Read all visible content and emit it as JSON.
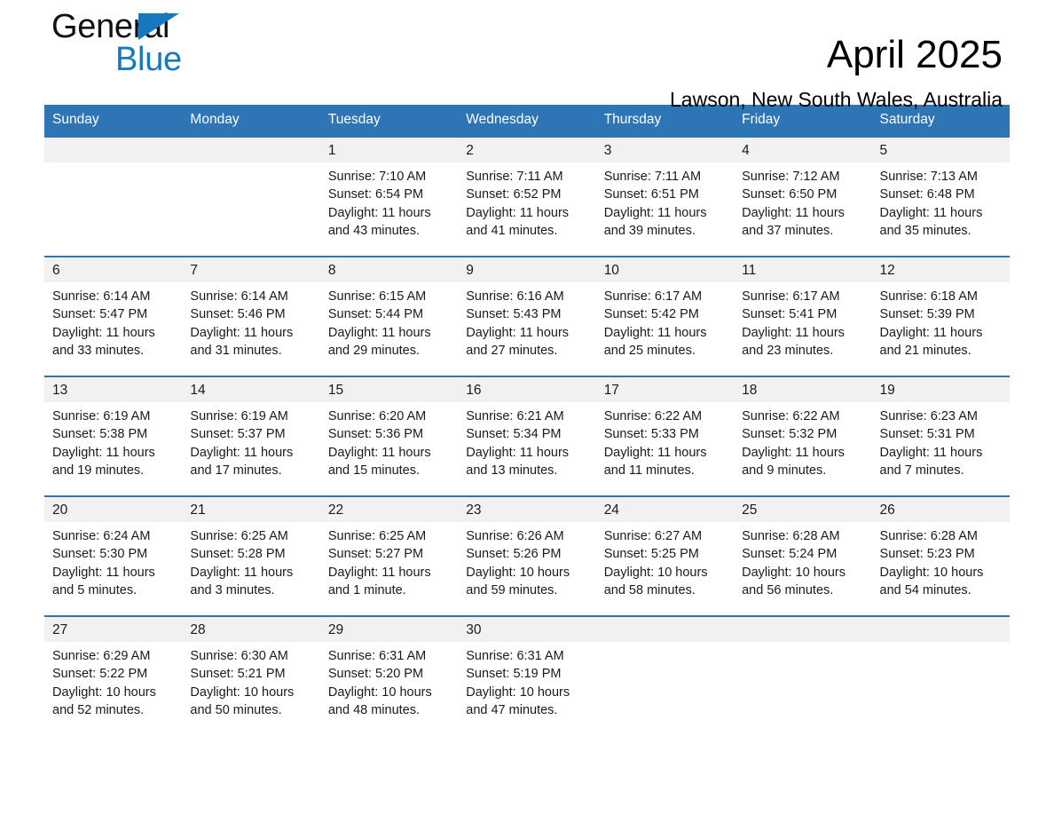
{
  "brand": {
    "name_part1": "General",
    "name_part2": "Blue",
    "accent_color": "#1878be"
  },
  "header": {
    "title": "April 2025",
    "subtitle": "Lawson, New South Wales, Australia"
  },
  "theme": {
    "header_blue": "#2e75b6",
    "daynum_band_gray": "#f1f1f1",
    "divider_blue": "#2e75b6"
  },
  "weekday_headers": [
    "Sunday",
    "Monday",
    "Tuesday",
    "Wednesday",
    "Thursday",
    "Friday",
    "Saturday"
  ],
  "labels": {
    "sunrise_prefix": "Sunrise:",
    "sunset_prefix": "Sunset:",
    "daylight_prefix": "Daylight:"
  },
  "weeks": [
    [
      {
        "day": "",
        "sunrise": "",
        "sunset": "",
        "daylight_line1": "",
        "daylight_line2": ""
      },
      {
        "day": "",
        "sunrise": "",
        "sunset": "",
        "daylight_line1": "",
        "daylight_line2": ""
      },
      {
        "day": "1",
        "sunrise": "Sunrise: 7:10 AM",
        "sunset": "Sunset: 6:54 PM",
        "daylight_line1": "Daylight: 11 hours",
        "daylight_line2": "and 43 minutes."
      },
      {
        "day": "2",
        "sunrise": "Sunrise: 7:11 AM",
        "sunset": "Sunset: 6:52 PM",
        "daylight_line1": "Daylight: 11 hours",
        "daylight_line2": "and 41 minutes."
      },
      {
        "day": "3",
        "sunrise": "Sunrise: 7:11 AM",
        "sunset": "Sunset: 6:51 PM",
        "daylight_line1": "Daylight: 11 hours",
        "daylight_line2": "and 39 minutes."
      },
      {
        "day": "4",
        "sunrise": "Sunrise: 7:12 AM",
        "sunset": "Sunset: 6:50 PM",
        "daylight_line1": "Daylight: 11 hours",
        "daylight_line2": "and 37 minutes."
      },
      {
        "day": "5",
        "sunrise": "Sunrise: 7:13 AM",
        "sunset": "Sunset: 6:48 PM",
        "daylight_line1": "Daylight: 11 hours",
        "daylight_line2": "and 35 minutes."
      }
    ],
    [
      {
        "day": "6",
        "sunrise": "Sunrise: 6:14 AM",
        "sunset": "Sunset: 5:47 PM",
        "daylight_line1": "Daylight: 11 hours",
        "daylight_line2": "and 33 minutes."
      },
      {
        "day": "7",
        "sunrise": "Sunrise: 6:14 AM",
        "sunset": "Sunset: 5:46 PM",
        "daylight_line1": "Daylight: 11 hours",
        "daylight_line2": "and 31 minutes."
      },
      {
        "day": "8",
        "sunrise": "Sunrise: 6:15 AM",
        "sunset": "Sunset: 5:44 PM",
        "daylight_line1": "Daylight: 11 hours",
        "daylight_line2": "and 29 minutes."
      },
      {
        "day": "9",
        "sunrise": "Sunrise: 6:16 AM",
        "sunset": "Sunset: 5:43 PM",
        "daylight_line1": "Daylight: 11 hours",
        "daylight_line2": "and 27 minutes."
      },
      {
        "day": "10",
        "sunrise": "Sunrise: 6:17 AM",
        "sunset": "Sunset: 5:42 PM",
        "daylight_line1": "Daylight: 11 hours",
        "daylight_line2": "and 25 minutes."
      },
      {
        "day": "11",
        "sunrise": "Sunrise: 6:17 AM",
        "sunset": "Sunset: 5:41 PM",
        "daylight_line1": "Daylight: 11 hours",
        "daylight_line2": "and 23 minutes."
      },
      {
        "day": "12",
        "sunrise": "Sunrise: 6:18 AM",
        "sunset": "Sunset: 5:39 PM",
        "daylight_line1": "Daylight: 11 hours",
        "daylight_line2": "and 21 minutes."
      }
    ],
    [
      {
        "day": "13",
        "sunrise": "Sunrise: 6:19 AM",
        "sunset": "Sunset: 5:38 PM",
        "daylight_line1": "Daylight: 11 hours",
        "daylight_line2": "and 19 minutes."
      },
      {
        "day": "14",
        "sunrise": "Sunrise: 6:19 AM",
        "sunset": "Sunset: 5:37 PM",
        "daylight_line1": "Daylight: 11 hours",
        "daylight_line2": "and 17 minutes."
      },
      {
        "day": "15",
        "sunrise": "Sunrise: 6:20 AM",
        "sunset": "Sunset: 5:36 PM",
        "daylight_line1": "Daylight: 11 hours",
        "daylight_line2": "and 15 minutes."
      },
      {
        "day": "16",
        "sunrise": "Sunrise: 6:21 AM",
        "sunset": "Sunset: 5:34 PM",
        "daylight_line1": "Daylight: 11 hours",
        "daylight_line2": "and 13 minutes."
      },
      {
        "day": "17",
        "sunrise": "Sunrise: 6:22 AM",
        "sunset": "Sunset: 5:33 PM",
        "daylight_line1": "Daylight: 11 hours",
        "daylight_line2": "and 11 minutes."
      },
      {
        "day": "18",
        "sunrise": "Sunrise: 6:22 AM",
        "sunset": "Sunset: 5:32 PM",
        "daylight_line1": "Daylight: 11 hours",
        "daylight_line2": "and 9 minutes."
      },
      {
        "day": "19",
        "sunrise": "Sunrise: 6:23 AM",
        "sunset": "Sunset: 5:31 PM",
        "daylight_line1": "Daylight: 11 hours",
        "daylight_line2": "and 7 minutes."
      }
    ],
    [
      {
        "day": "20",
        "sunrise": "Sunrise: 6:24 AM",
        "sunset": "Sunset: 5:30 PM",
        "daylight_line1": "Daylight: 11 hours",
        "daylight_line2": "and 5 minutes."
      },
      {
        "day": "21",
        "sunrise": "Sunrise: 6:25 AM",
        "sunset": "Sunset: 5:28 PM",
        "daylight_line1": "Daylight: 11 hours",
        "daylight_line2": "and 3 minutes."
      },
      {
        "day": "22",
        "sunrise": "Sunrise: 6:25 AM",
        "sunset": "Sunset: 5:27 PM",
        "daylight_line1": "Daylight: 11 hours",
        "daylight_line2": "and 1 minute."
      },
      {
        "day": "23",
        "sunrise": "Sunrise: 6:26 AM",
        "sunset": "Sunset: 5:26 PM",
        "daylight_line1": "Daylight: 10 hours",
        "daylight_line2": "and 59 minutes."
      },
      {
        "day": "24",
        "sunrise": "Sunrise: 6:27 AM",
        "sunset": "Sunset: 5:25 PM",
        "daylight_line1": "Daylight: 10 hours",
        "daylight_line2": "and 58 minutes."
      },
      {
        "day": "25",
        "sunrise": "Sunrise: 6:28 AM",
        "sunset": "Sunset: 5:24 PM",
        "daylight_line1": "Daylight: 10 hours",
        "daylight_line2": "and 56 minutes."
      },
      {
        "day": "26",
        "sunrise": "Sunrise: 6:28 AM",
        "sunset": "Sunset: 5:23 PM",
        "daylight_line1": "Daylight: 10 hours",
        "daylight_line2": "and 54 minutes."
      }
    ],
    [
      {
        "day": "27",
        "sunrise": "Sunrise: 6:29 AM",
        "sunset": "Sunset: 5:22 PM",
        "daylight_line1": "Daylight: 10 hours",
        "daylight_line2": "and 52 minutes."
      },
      {
        "day": "28",
        "sunrise": "Sunrise: 6:30 AM",
        "sunset": "Sunset: 5:21 PM",
        "daylight_line1": "Daylight: 10 hours",
        "daylight_line2": "and 50 minutes."
      },
      {
        "day": "29",
        "sunrise": "Sunrise: 6:31 AM",
        "sunset": "Sunset: 5:20 PM",
        "daylight_line1": "Daylight: 10 hours",
        "daylight_line2": "and 48 minutes."
      },
      {
        "day": "30",
        "sunrise": "Sunrise: 6:31 AM",
        "sunset": "Sunset: 5:19 PM",
        "daylight_line1": "Daylight: 10 hours",
        "daylight_line2": "and 47 minutes."
      },
      {
        "day": "",
        "sunrise": "",
        "sunset": "",
        "daylight_line1": "",
        "daylight_line2": ""
      },
      {
        "day": "",
        "sunrise": "",
        "sunset": "",
        "daylight_line1": "",
        "daylight_line2": ""
      },
      {
        "day": "",
        "sunrise": "",
        "sunset": "",
        "daylight_line1": "",
        "daylight_line2": ""
      }
    ]
  ]
}
